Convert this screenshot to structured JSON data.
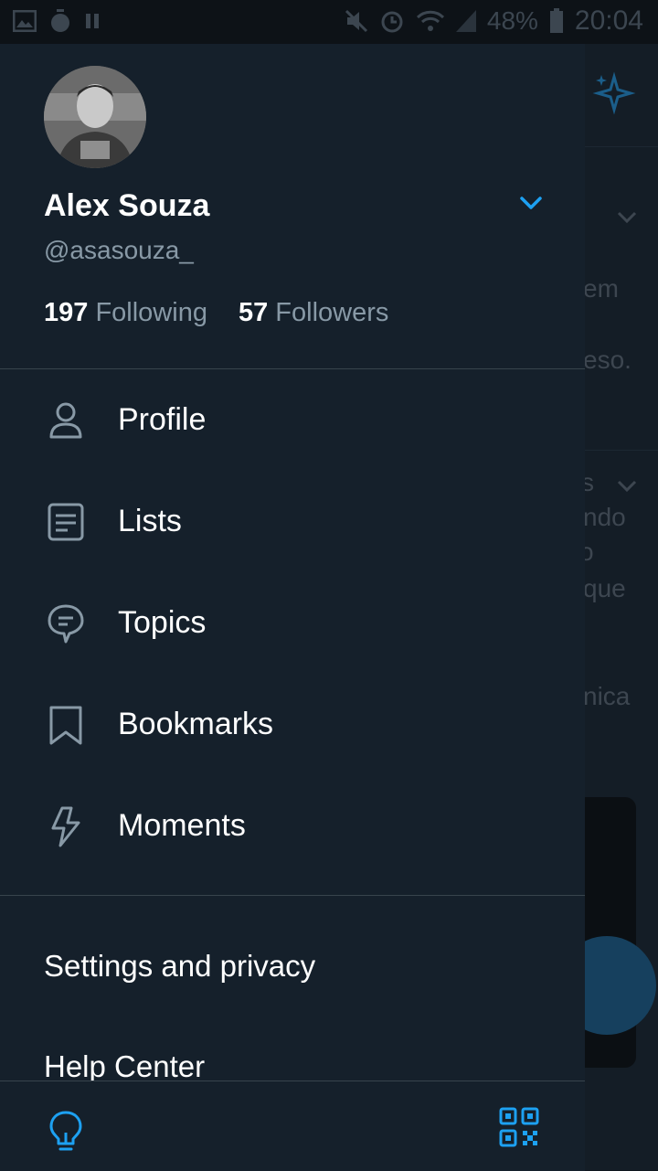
{
  "status_bar": {
    "battery_percent": "48%",
    "time": "20:04"
  },
  "background_feed": {
    "fragments": [
      "em",
      "eso.",
      "s",
      "ndo",
      "o",
      "que",
      "nica"
    ]
  },
  "profile": {
    "name": "Alex Souza",
    "handle": "@asasouza_",
    "following_count": "197",
    "following_label": "Following",
    "followers_count": "57",
    "followers_label": "Followers"
  },
  "menu": {
    "items": [
      {
        "label": "Profile",
        "icon": "person-icon"
      },
      {
        "label": "Lists",
        "icon": "list-icon"
      },
      {
        "label": "Topics",
        "icon": "topics-icon"
      },
      {
        "label": "Bookmarks",
        "icon": "bookmark-icon"
      },
      {
        "label": "Moments",
        "icon": "lightning-icon"
      }
    ],
    "settings_label": "Settings and privacy",
    "help_label": "Help Center"
  },
  "colors": {
    "accent": "#1da1f2",
    "drawer_bg": "#15202b",
    "secondary_text": "#8899a6"
  }
}
